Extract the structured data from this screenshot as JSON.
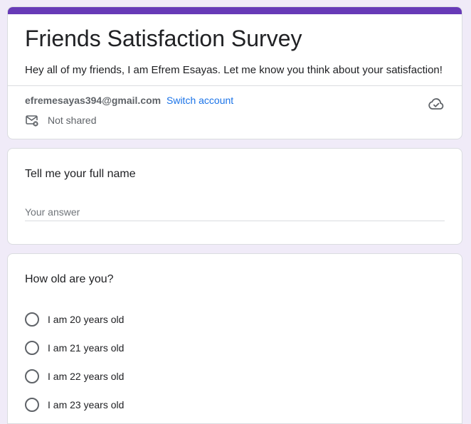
{
  "form": {
    "title": "Friends Satisfaction Survey",
    "description": "Hey all of my friends, I am Efrem Esayas. Let me know you think about your satisfaction!",
    "accent_color": "#673ab7"
  },
  "account": {
    "email": "efremesayas394@gmail.com",
    "switch_label": "Switch account",
    "shared_status": "Not shared",
    "sync_icon": "cloud-check-icon",
    "shared_icon": "mail-off-icon"
  },
  "questions": {
    "name": {
      "title": "Tell me your full name",
      "placeholder": "Your answer",
      "value": ""
    },
    "age": {
      "title": "How old are you?",
      "options": [
        "I am 20 years old",
        "I am 21 years old",
        "I am 22 years old",
        "I am 23 years old"
      ]
    }
  }
}
